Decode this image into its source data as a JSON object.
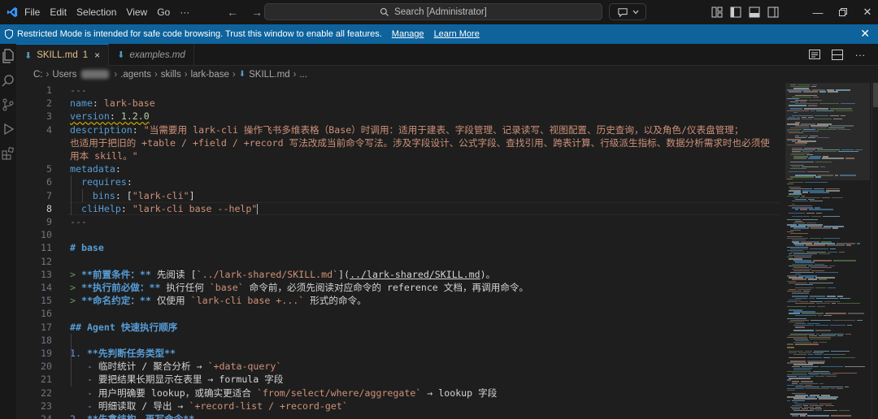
{
  "menu": [
    "File",
    "Edit",
    "Selection",
    "View",
    "Go"
  ],
  "search": {
    "label": "Search [Administrator]"
  },
  "banner": {
    "message": "Restricted Mode is intended for safe code browsing. Trust this window to enable all features.",
    "manage": "Manage",
    "learn_more": "Learn More"
  },
  "tabs": [
    {
      "name": "SKILL.md",
      "badge": "1",
      "close": "×"
    },
    {
      "name": "examples.md"
    }
  ],
  "breadcrumb": {
    "drive": "C:",
    "users": "Users",
    "agents": ".agents",
    "skills": "skills",
    "lark_base": "lark-base",
    "file": "SKILL.md",
    "more": "..."
  },
  "editor": {
    "current_line": "8",
    "lines": [
      {
        "n": "1",
        "parts": [
          [
            "c-dash",
            "---"
          ]
        ]
      },
      {
        "n": "2",
        "parts": [
          [
            "c-key",
            "name"
          ],
          [
            "c-plain",
            ": "
          ],
          [
            "c-str",
            "lark-base"
          ]
        ]
      },
      {
        "n": "3",
        "parts": [
          [
            "c-key squig",
            "version"
          ],
          [
            "c-plain squig",
            ": "
          ],
          [
            "c-num squig",
            "1.2.0"
          ]
        ]
      },
      {
        "n": "4",
        "parts": [
          [
            "c-key",
            "description"
          ],
          [
            "c-plain",
            ": "
          ],
          [
            "c-str",
            "\"当需要用 lark-cli 操作飞书多维表格（Base）时调用：适用于建表、字段管理、记录读写、视图配置、历史查询，以及角色/仪表盘管理；"
          ]
        ]
      },
      {
        "n": "",
        "parts": [
          [
            "c-str",
            "也适用于把旧的 +table / +field / +record 写法改成当前命令写法。涉及字段设计、公式字段、查找引用、跨表计算、行级派生指标、数据分析需求时也必须使"
          ]
        ]
      },
      {
        "n": "",
        "parts": [
          [
            "c-str",
            "用本 skill。\""
          ]
        ]
      },
      {
        "n": "5",
        "parts": [
          [
            "c-key",
            "metadata"
          ],
          [
            "c-plain",
            ":"
          ]
        ]
      },
      {
        "n": "6",
        "parts": [
          [
            "c-plain",
            "  "
          ],
          [
            "c-key",
            "requires"
          ],
          [
            "c-plain",
            ":"
          ]
        ]
      },
      {
        "n": "7",
        "parts": [
          [
            "c-plain",
            "    "
          ],
          [
            "c-key",
            "bins"
          ],
          [
            "c-plain",
            ": ["
          ],
          [
            "c-str",
            "\"lark-cli\""
          ],
          [
            "c-plain",
            "]"
          ]
        ]
      },
      {
        "n": "8",
        "parts": [
          [
            "c-plain",
            "  "
          ],
          [
            "c-key",
            "cliHelp"
          ],
          [
            "c-plain",
            ": "
          ],
          [
            "c-str",
            "\"lark-cli base --help\""
          ]
        ],
        "caret": true
      },
      {
        "n": "9",
        "parts": [
          [
            "c-dash",
            "---"
          ]
        ]
      },
      {
        "n": "10",
        "parts": []
      },
      {
        "n": "11",
        "parts": [
          [
            "c-head",
            "# base"
          ]
        ]
      },
      {
        "n": "12",
        "parts": []
      },
      {
        "n": "13",
        "parts": [
          [
            "c-quote",
            "> "
          ],
          [
            "c-bold",
            "**前置条件：**"
          ],
          [
            "c-plain",
            " 先阅读 ["
          ],
          [
            "c-code",
            "`../lark-shared/SKILL.md`"
          ],
          [
            "c-plain",
            "]("
          ],
          [
            "c-link",
            "../lark-shared/SKILL.md"
          ],
          [
            "c-plain",
            ")。"
          ]
        ]
      },
      {
        "n": "14",
        "parts": [
          [
            "c-quote",
            "> "
          ],
          [
            "c-bold",
            "**执行前必做：**"
          ],
          [
            "c-plain",
            " 执行任何 "
          ],
          [
            "c-code",
            "`base`"
          ],
          [
            "c-plain",
            " 命令前，必须先阅读对应命令的 reference 文档，再调用命令。"
          ]
        ]
      },
      {
        "n": "15",
        "parts": [
          [
            "c-quote",
            "> "
          ],
          [
            "c-bold",
            "**命名约定：**"
          ],
          [
            "c-plain",
            " 仅使用 "
          ],
          [
            "c-code",
            "`lark-cli base +...`"
          ],
          [
            "c-plain",
            " 形式的命令。"
          ]
        ]
      },
      {
        "n": "16",
        "parts": []
      },
      {
        "n": "17",
        "parts": [
          [
            "c-head",
            "## Agent 快速执行顺序"
          ]
        ]
      },
      {
        "n": "18",
        "parts": []
      },
      {
        "n": "19",
        "parts": [
          [
            "c-list",
            "1. "
          ],
          [
            "c-bold",
            "**先判断任务类型**"
          ]
        ]
      },
      {
        "n": "20",
        "parts": [
          [
            "c-plain",
            "   "
          ],
          [
            "c-list",
            "- "
          ],
          [
            "c-plain",
            "临时统计 / 聚合分析 → "
          ],
          [
            "c-code",
            "`+data-query`"
          ]
        ]
      },
      {
        "n": "21",
        "parts": [
          [
            "c-plain",
            "   "
          ],
          [
            "c-list",
            "- "
          ],
          [
            "c-plain",
            "要把结果长期显示在表里 → formula 字段"
          ]
        ]
      },
      {
        "n": "22",
        "parts": [
          [
            "c-plain",
            "   "
          ],
          [
            "c-list",
            "- "
          ],
          [
            "c-plain",
            "用户明确要 lookup，或确实更适合 "
          ],
          [
            "c-code",
            "`from/select/where/aggregate`"
          ],
          [
            "c-plain",
            " → lookup 字段"
          ]
        ]
      },
      {
        "n": "23",
        "parts": [
          [
            "c-plain",
            "   "
          ],
          [
            "c-list",
            "- "
          ],
          [
            "c-plain",
            "明细读取 / 导出 → "
          ],
          [
            "c-code",
            "`+record-list / +record-get`"
          ]
        ]
      },
      {
        "n": "24",
        "parts": [
          [
            "c-list",
            "2. "
          ],
          [
            "c-bold",
            "**先拿结构，再写命令**"
          ]
        ]
      }
    ]
  }
}
